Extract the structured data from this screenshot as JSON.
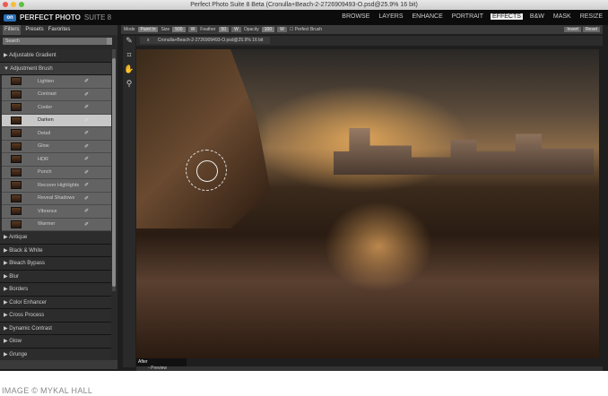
{
  "window": {
    "title": "Perfect Photo Suite 8 Beta (Cronulla+Beach-2-2726909493-O.psd@25.9% 16 bit)"
  },
  "app": {
    "logo_text": "PERFECT PHOTO",
    "logo_suffix": "SUITE 8",
    "logo_mark": "on1",
    "nav": [
      "BROWSE",
      "LAYERS",
      "ENHANCE",
      "PORTRAIT",
      "EFFECTS",
      "B&W",
      "MASK",
      "RESIZE"
    ],
    "active_nav": "EFFECTS"
  },
  "panel": {
    "tabs": [
      "Filters",
      "Presets",
      "Favorites"
    ],
    "active_tab": "Filters",
    "search_placeholder": "Search",
    "categories_top": [
      "Adjustable Gradient",
      "Adjustment Brush"
    ],
    "brush_items": [
      "Lighten",
      "Contrast",
      "Cooler",
      "Darken",
      "Detail",
      "Glow",
      "HDR",
      "Punch",
      "Recover Highlights",
      "Reveal Shadows",
      "Vibrance",
      "Warmer"
    ],
    "selected_item": "Darken",
    "categories": [
      "Antique",
      "Black & White",
      "Bleach Bypass",
      "Blur",
      "Borders",
      "Color Enhancer",
      "Cross Process",
      "Dynamic Contrast",
      "Glow",
      "Grunge"
    ]
  },
  "toolbar": {
    "mode_label": "Mode",
    "mode_value": "Paint In",
    "size_label": "Size",
    "size_value": "500",
    "feather_label": "Feather",
    "feather_value": "50",
    "opacity_label": "Opacity",
    "opacity_value": "100",
    "w": "W",
    "perfect_brush": "Perfect Brush",
    "invert": "Invert",
    "reset": "Reset"
  },
  "document": {
    "tab": "Cronulla+Beach-2-2726909493-O.psd@25.9% 16 bit",
    "close": "x"
  },
  "view": {
    "after_label": "After",
    "preview_label": "Preview"
  },
  "caption": "IMAGE © MYKAL HALL"
}
